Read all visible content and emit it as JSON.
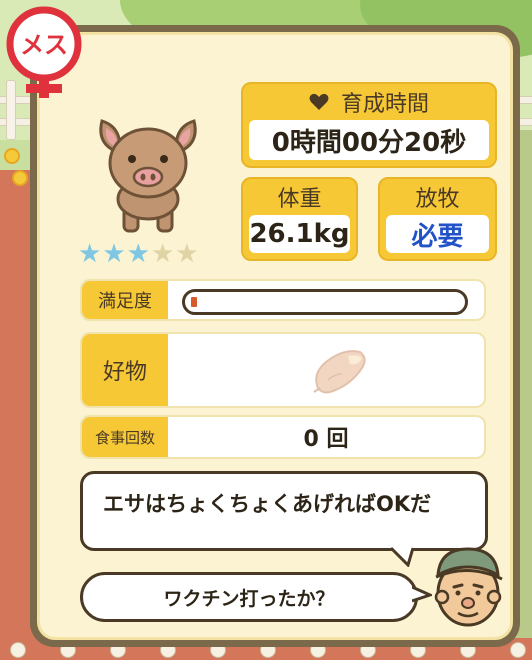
{
  "gender_badge": {
    "label": "メス",
    "color": "#e0323c"
  },
  "pet": {
    "species_icon": "pig-icon",
    "star_rating": 3,
    "star_max": 5
  },
  "growth_time": {
    "header": "育成時間",
    "value": "0時間00分20秒"
  },
  "weight": {
    "header": "体重",
    "value": "26.1kg"
  },
  "grazing": {
    "header": "放牧",
    "value": "必要"
  },
  "satisfaction": {
    "label": "満足度",
    "level": 0.02
  },
  "favorite": {
    "label": "好物",
    "item_icon": "sweet-potato-icon"
  },
  "meals": {
    "label": "食事回数",
    "value": "0 回"
  },
  "dialog": {
    "message_1": "エサはちょくちょくあげればOKだ",
    "message_2": "ワクチン打ったか？",
    "speaker_icon": "farmer-icon"
  },
  "colors": {
    "accent": "#f6c836",
    "panel_border": "#7a6a4b",
    "panel_bg": "#fbf3d1",
    "star_on": "#7fc7e3",
    "star_off": "#e0d3a6",
    "grazing_value": "#2252c8",
    "satisfaction_fill": "#d85a2a"
  }
}
